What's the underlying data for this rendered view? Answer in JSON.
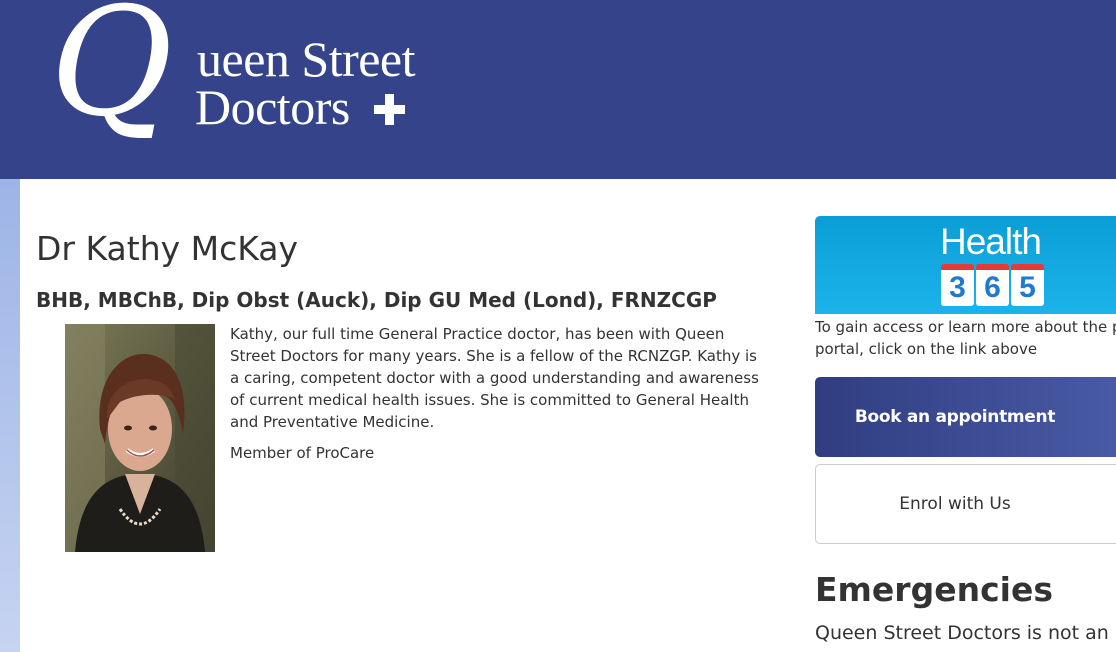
{
  "header": {
    "logo_text_q": "Q",
    "logo_line1": "ueen Street",
    "logo_line2": "Doctors",
    "logo_icon": "plus-icon",
    "bg_color": "#35448a"
  },
  "doctor": {
    "name": "Dr Kathy McKay",
    "qualifications": "BHB, MBChB, Dip Obst (Auck), Dip GU Med (Lond), FRNZCGP",
    "bio": "Kathy, our full time General Practice doctor, has been with Queen Street Doctors for many years. She is a fellow of the RCNZGP. Kathy is a caring, competent doctor with a good understanding and awareness of current medical health issues. She is committed to General Health and Preventative Medicine.",
    "membership": "Member of ProCare"
  },
  "sidebar": {
    "health365": {
      "title": "Health",
      "digits": [
        "3",
        "6",
        "5"
      ]
    },
    "portal_text_line1": "To gain access or learn more about the pa",
    "portal_text_line2": "portal, click on the link above",
    "book_button": "Book an appointment",
    "enrol_button": "Enrol with Us",
    "emergencies_title": "Emergencies",
    "emergencies_text": "Queen Street Doctors is not an"
  },
  "colors": {
    "brand": "#35448a",
    "health_blue": "#0b9ed6",
    "text": "#333333"
  }
}
